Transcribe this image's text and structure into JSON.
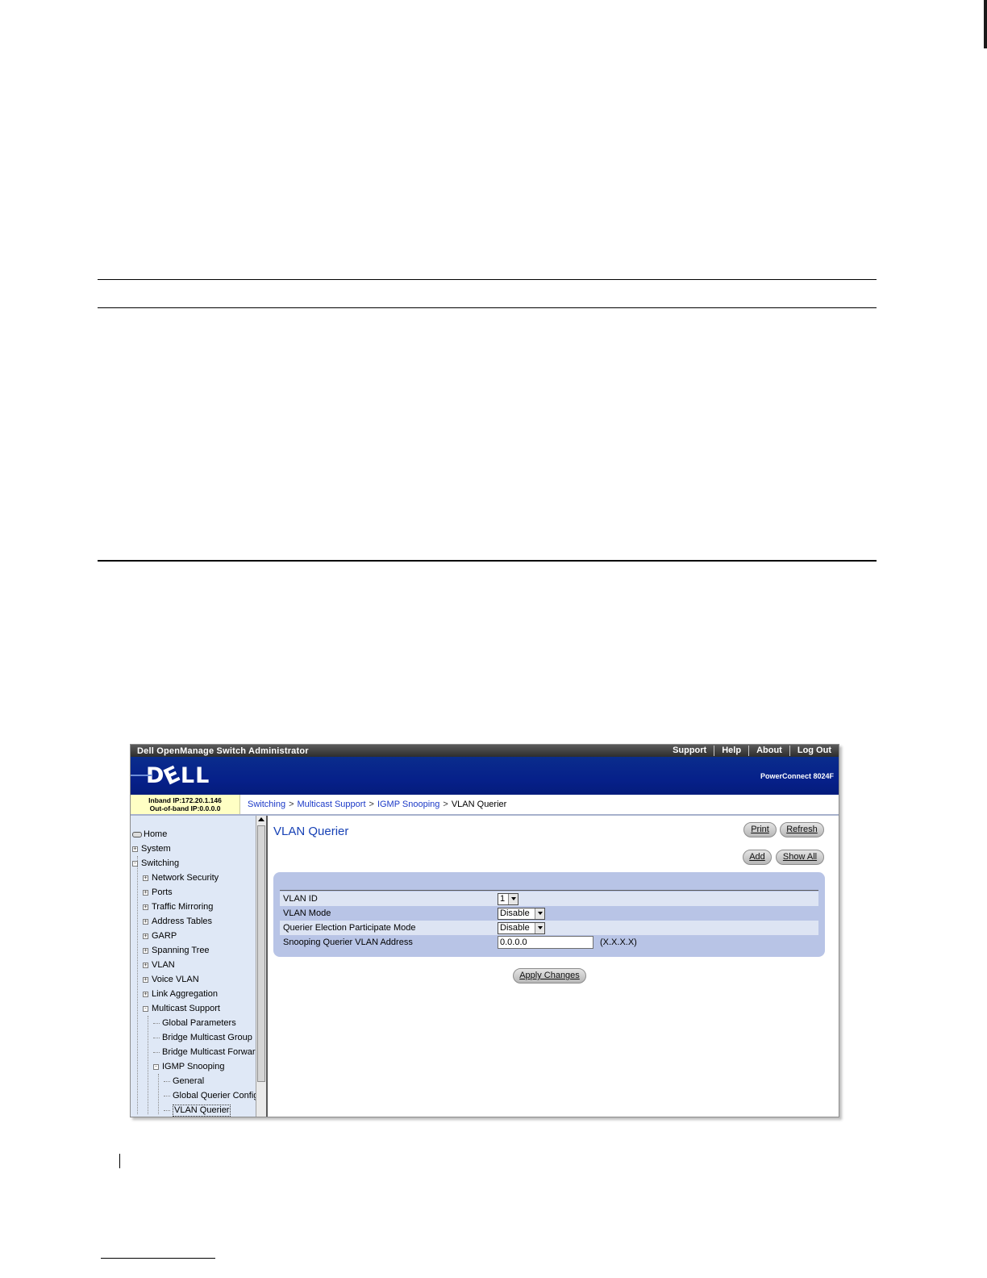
{
  "window": {
    "app_title": "Dell OpenManage Switch Administrator",
    "top_links": [
      "Support",
      "Help",
      "About",
      "Log Out"
    ]
  },
  "banner": {
    "logo_text": "DELL",
    "product": "PowerConnect 8024F"
  },
  "infobar": {
    "inband_ip": "Inband IP:172.20.1.146",
    "oob_ip": "Out-of-band IP:0.0.0.0"
  },
  "breadcrumb": {
    "items": [
      "Switching",
      "Multicast Support",
      "IGMP Snooping"
    ],
    "separator": ">",
    "current": "VLAN Querier"
  },
  "tree": {
    "items": [
      {
        "label": "Home",
        "level": 0,
        "kind": "home"
      },
      {
        "label": "System",
        "level": 0,
        "kind": "plus"
      },
      {
        "label": "Switching",
        "level": 0,
        "kind": "minus"
      },
      {
        "label": "Network Security",
        "level": 1,
        "kind": "plus"
      },
      {
        "label": "Ports",
        "level": 1,
        "kind": "plus"
      },
      {
        "label": "Traffic Mirroring",
        "level": 1,
        "kind": "plus"
      },
      {
        "label": "Address Tables",
        "level": 1,
        "kind": "plus"
      },
      {
        "label": "GARP",
        "level": 1,
        "kind": "plus"
      },
      {
        "label": "Spanning Tree",
        "level": 1,
        "kind": "plus"
      },
      {
        "label": "VLAN",
        "level": 1,
        "kind": "plus"
      },
      {
        "label": "Voice VLAN",
        "level": 1,
        "kind": "plus"
      },
      {
        "label": "Link Aggregation",
        "level": 1,
        "kind": "plus"
      },
      {
        "label": "Multicast Support",
        "level": 1,
        "kind": "minus"
      },
      {
        "label": "Global Parameters",
        "level": 2,
        "kind": "leaf"
      },
      {
        "label": "Bridge Multicast Group",
        "level": 2,
        "kind": "leaf"
      },
      {
        "label": "Bridge Multicast Forwardir",
        "level": 2,
        "kind": "leaf"
      },
      {
        "label": "IGMP Snooping",
        "level": 2,
        "kind": "minus"
      },
      {
        "label": "General",
        "level": 3,
        "kind": "leaf"
      },
      {
        "label": "Global Querier Configur",
        "level": 3,
        "kind": "leaf"
      },
      {
        "label": "VLAN Querier",
        "level": 3,
        "kind": "leaf",
        "selected": true
      }
    ]
  },
  "main": {
    "title": "VLAN Querier",
    "buttons": {
      "print": "Print",
      "refresh": "Refresh",
      "add": "Add",
      "show_all": "Show All",
      "apply": "Apply Changes"
    },
    "form": {
      "vlan_id_label": "VLAN ID",
      "vlan_id_value": "1",
      "vlan_mode_label": "VLAN Mode",
      "vlan_mode_value": "Disable",
      "querier_election_label": "Querier Election Participate Mode",
      "querier_election_value": "Disable",
      "snooping_address_label": "Snooping Querier VLAN Address",
      "snooping_address_value": "0.0.0.0",
      "snooping_address_hint": "(X.X.X.X)"
    }
  },
  "colors": {
    "banner": "#06208a",
    "link": "#1b39c7",
    "title": "#1741b5",
    "panel": "#b8c4e6",
    "sidebar": "#dfe8f6",
    "ip_box": "#ffffc4"
  }
}
